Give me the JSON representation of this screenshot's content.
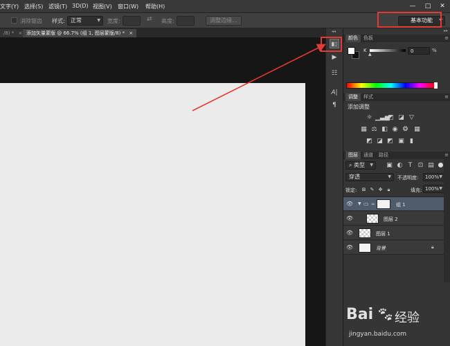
{
  "menubar": {
    "items": [
      "文字(Y)",
      "选择(S)",
      "滤镜(T)",
      "3D(D)",
      "视图(V)",
      "窗口(W)",
      "帮助(H)"
    ],
    "window_controls": [
      "—",
      "□",
      "✕"
    ]
  },
  "options_bar": {
    "antialias_label": "消除锯齿",
    "style_label": "样式:",
    "style_value": "正常",
    "width_label": "宽度:",
    "height_label": "高度:",
    "refine_edge_label": "调整边缘...",
    "workspace_value": "基本功能"
  },
  "tabs": [
    {
      "label": "/8) *",
      "close": "×"
    },
    {
      "label": "添加矢量蒙版 @ 66.7% (组 1, 图层蒙版/8) *",
      "close": "×"
    }
  ],
  "color_panel": {
    "tabs": [
      "颜色",
      "色板"
    ],
    "channel_label": "K",
    "channel_value": "0",
    "unit": "%"
  },
  "adjustments_panel": {
    "tabs": [
      "调整",
      "样式"
    ],
    "title": "添加调整"
  },
  "layers_panel": {
    "tabs": [
      "图层",
      "通道",
      "路径"
    ],
    "filter_kind": "类型",
    "blend_mode": "穿透",
    "opacity_label": "不透明度:",
    "opacity_value": "100%",
    "lock_label": "锁定:",
    "fill_label": "填充:",
    "fill_value": "100%",
    "layers": [
      {
        "name": "组 1",
        "selected": true
      },
      {
        "name": "图层 2",
        "selected": false
      },
      {
        "name": "图层 1",
        "selected": false
      },
      {
        "name": "背景",
        "selected": false
      }
    ]
  },
  "watermark": {
    "brand_left": "Bai",
    "brand_right": "经验",
    "url": "jingyan.baidu.com"
  },
  "colors": {
    "highlight": "#e53935",
    "canvas": "#ebebeb"
  }
}
